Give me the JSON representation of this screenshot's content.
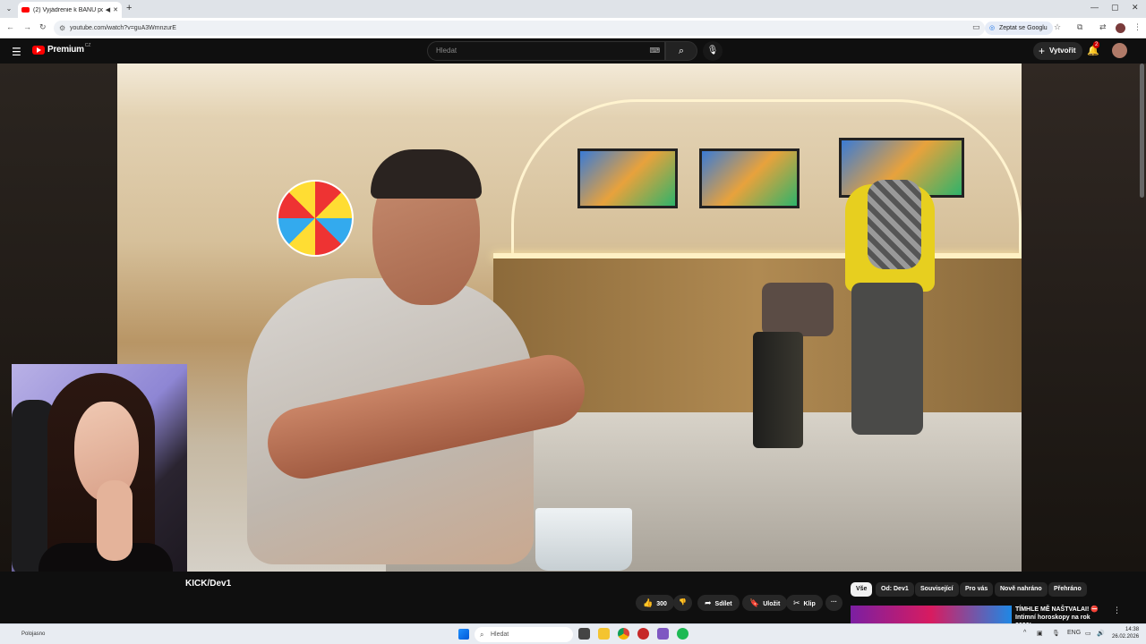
{
  "browser": {
    "tab_title": "(2) Vyjádrenie k BANU poc",
    "url": "youtube.com/watch?v=guA3WmnzurE",
    "ask_google": "Zeptat se Googlu"
  },
  "youtube": {
    "logo_text": "Premium",
    "region_code": "CZ",
    "search_placeholder": "Hledat",
    "create_label": "Vytvořit",
    "notification_count": "2"
  },
  "video": {
    "channel_partial": "KICK/Dev1"
  },
  "actions": {
    "like_count": "300",
    "share": "Sdílet",
    "save": "Uložit",
    "clip": "Klip",
    "more": "···"
  },
  "chips": [
    {
      "label": "Vše",
      "active": true
    },
    {
      "label": "Od: Dev1",
      "active": false
    },
    {
      "label": "Související",
      "active": false
    },
    {
      "label": "Pro vás",
      "active": false
    },
    {
      "label": "Nově nahráno",
      "active": false
    },
    {
      "label": "Přehráno",
      "active": false
    }
  ],
  "recommendation": {
    "title_line1": "TÍMHLE MĚ NAŠTVALAI! ⛔",
    "title_line2": "Intimní horoskopy na rok 2026!…"
  },
  "taskbar": {
    "weather": "Polojasno",
    "search_placeholder": "Hledat",
    "language": "ENG",
    "time": "14:38",
    "date": "26.02.2026"
  },
  "colors": {
    "yt_red": "#ff0000",
    "bg_dark": "#0f0f0f",
    "chip_bg": "#272727"
  }
}
